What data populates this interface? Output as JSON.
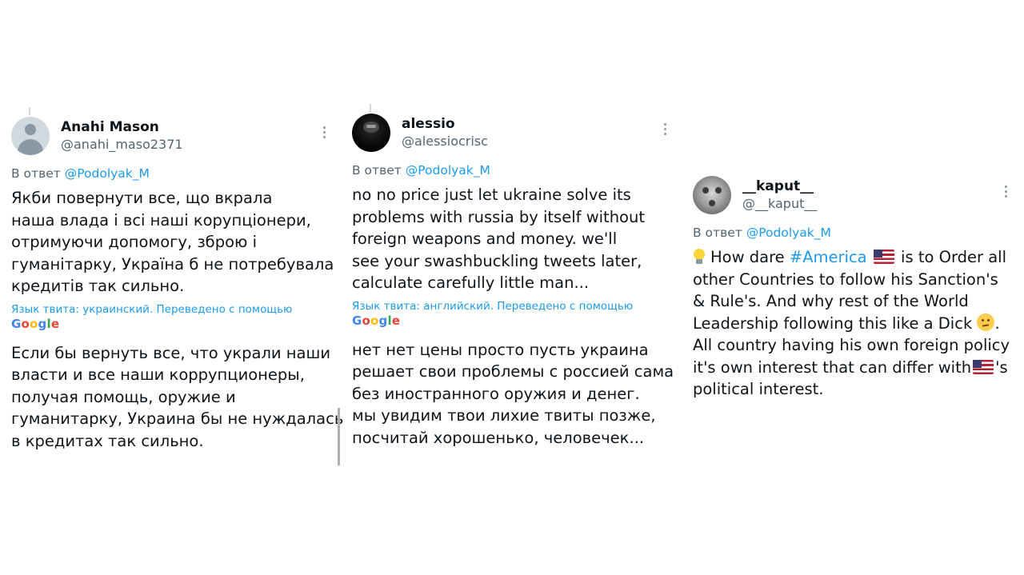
{
  "tweets": [
    {
      "name": "Anahi Mason",
      "handle": "@anahi_maso2371",
      "reply_prefix": "В ответ",
      "reply_to": "@Podolyak_M",
      "text_lines": [
        "Якби повернути все, що вкрала",
        "наша влада і всі наші корупціонери,",
        "отримуючи допомогу, зброю і",
        "гуманітарку, Україна б не потребувала",
        "кредитів так сильно."
      ],
      "translation_note": "Язык твита: украинский. Переведено с помощью",
      "translation_lines": [
        "Если бы вернуть все, что украли наши",
        "власти и все наши коррупционеры,",
        "получая помощь, оружие и",
        "гуманитарку, Украина бы не нуждалась",
        "в кредитах так сильно."
      ]
    },
    {
      "name": "alessio",
      "handle": "@alessiocrisc",
      "reply_prefix": "В ответ",
      "reply_to": "@Podolyak_M",
      "text_lines": [
        "no no price just let ukraine solve its",
        "problems with russia by itself without",
        "foreign weapons and money. we'll",
        "see your swashbuckling tweets later,",
        "calculate carefully little man..."
      ],
      "translation_note": "Язык твита: английский. Переведено с помощью",
      "translation_lines": [
        "нет нет цены просто пусть украина",
        "решает свои проблемы с россией сама",
        "без иностранного оружия и денег.",
        "мы увидим твои лихие твиты позже,",
        "посчитай хорошенько, человечек..."
      ]
    },
    {
      "name": "__kaput__",
      "handle": "@__kaput__",
      "reply_prefix": "В ответ",
      "reply_to": "@Podolyak_M",
      "line1_a": "How dare",
      "hashtag": "#America",
      "line1_b": "is to Order all",
      "line2": "other Countries to follow his Sanction's",
      "line3": "& Rule's. And why rest of the World",
      "line4": "Leadership following this like a Dick",
      "line4_end": ".",
      "line5": "All country having his own foreign policy",
      "line6_a": "it's own interest that can differ with",
      "line6_b": "'s",
      "line7": "political interest."
    }
  ],
  "google_logo": {
    "G": "G",
    "o1": "o",
    "o2": "o",
    "g": "g",
    "l": "l",
    "e": "e"
  },
  "icons": {
    "more": "more-vertical-icon",
    "flag": "us-flag-emoji",
    "bulb": "light-bulb-emoji",
    "thinking": "thinking-face-emoji"
  },
  "colors": {
    "link": "#1d9bf0",
    "secondary": "#536471",
    "text": "#0f1419"
  }
}
